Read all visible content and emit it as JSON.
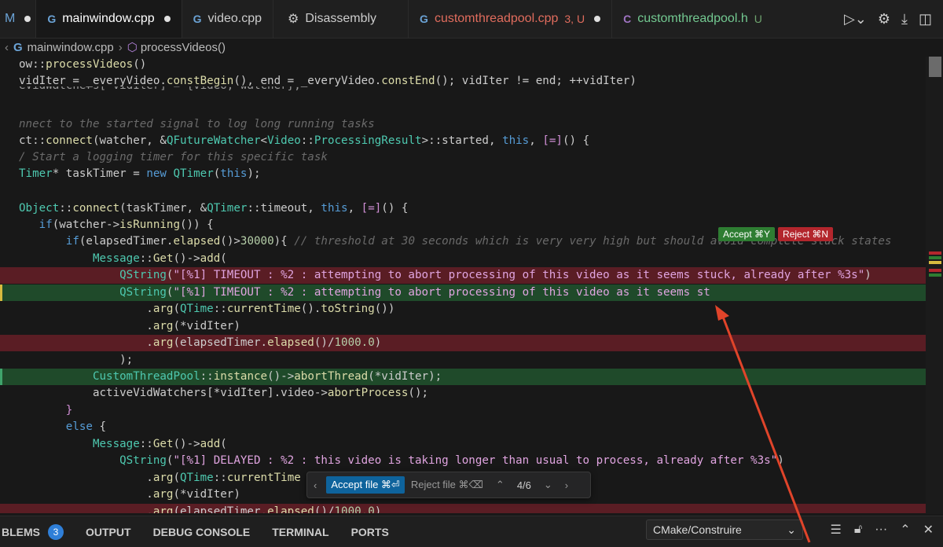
{
  "tabs": [
    {
      "label": "M",
      "status": ""
    },
    {
      "label": "mainwindow.cpp",
      "status": ""
    },
    {
      "label": "video.cpp",
      "status": ""
    },
    {
      "label": "Disassembly",
      "status": ""
    },
    {
      "label": "customthreadpool.cpp",
      "status": "3, U"
    },
    {
      "label": "customthreadpool.h",
      "status": "U"
    }
  ],
  "breadcrumb": {
    "file": "mainwindow.cpp",
    "symbol": "processVideos()"
  },
  "inline_actions": {
    "accept": "Accept ⌘Y",
    "reject": "Reject ⌘N"
  },
  "review_bar": {
    "accept": "Accept file ⌘⏎",
    "reject": "Reject file ⌘⌫",
    "counter": "4/6"
  },
  "panel": {
    "problems": "BLEMS",
    "problems_count": "3",
    "output": "OUTPUT",
    "debug": "DEBUG CONSOLE",
    "terminal": "TERMINAL",
    "ports": "PORTS",
    "task_select": "CMake/Construire"
  },
  "colors": {
    "deleted_line": "#5a1d24",
    "inserted_line": "#1f4a2a",
    "accent": "#0e639c",
    "arrow": "#e0442a"
  }
}
